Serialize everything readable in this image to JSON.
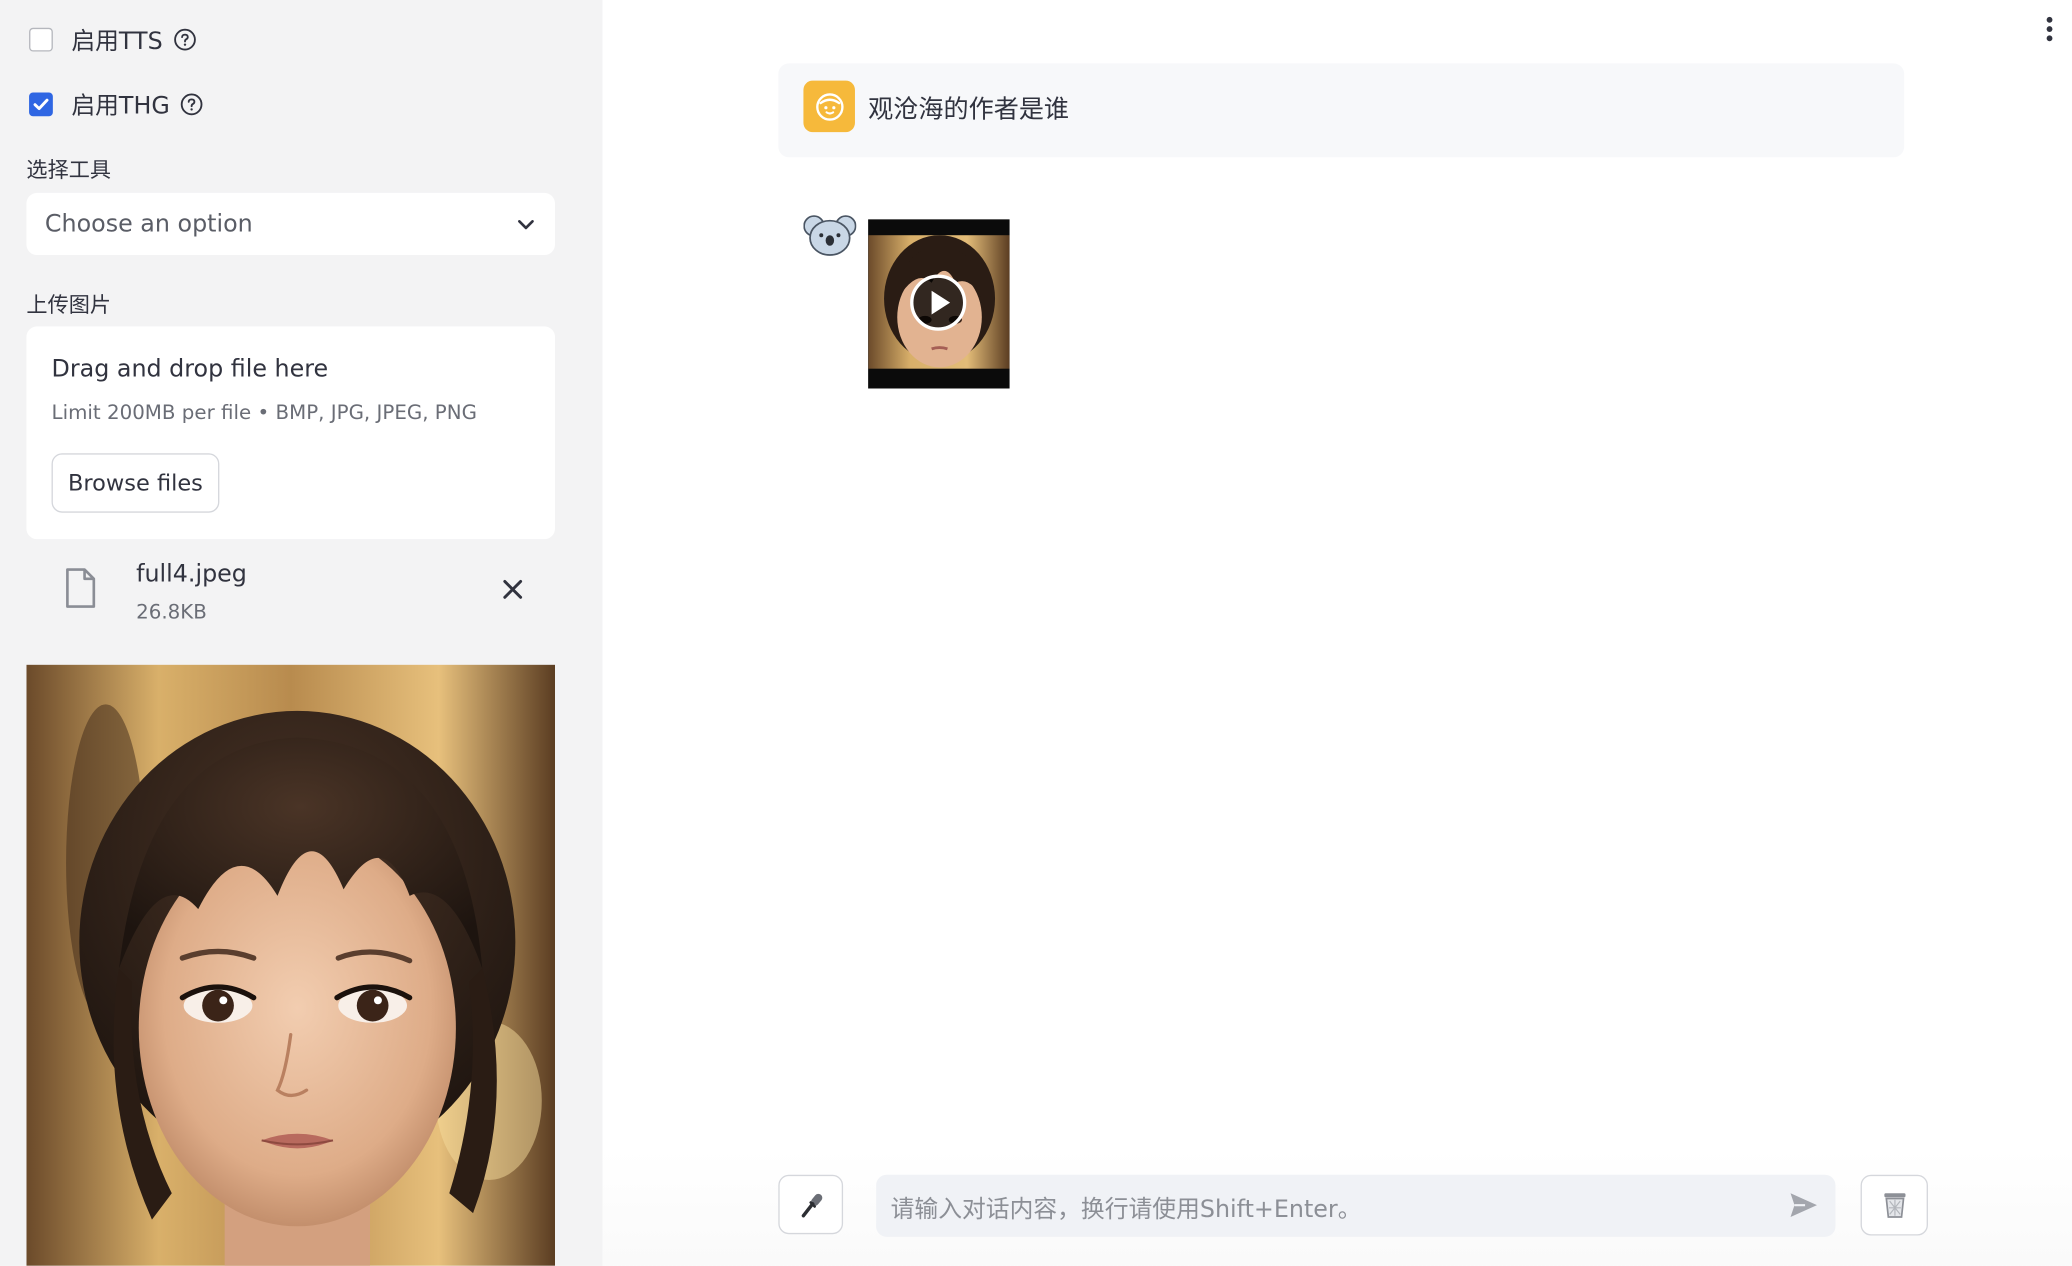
{
  "sidebar": {
    "tts": {
      "label": "启用TTS",
      "checked": false
    },
    "thg": {
      "label": "启用THG",
      "checked": true
    },
    "tool_select": {
      "label": "选择工具",
      "value": "Choose an option"
    },
    "upload": {
      "label": "上传图片",
      "drop_title": "Drag and drop file here",
      "limit": "Limit 200MB per file • BMP, JPG, JPEG, PNG",
      "browse_label": "Browse files"
    },
    "file": {
      "name": "full4.jpeg",
      "size": "26.8KB"
    }
  },
  "chat": {
    "messages": [
      {
        "role": "user",
        "text": "观沧海的作者是谁"
      },
      {
        "role": "assistant",
        "content": "video"
      }
    ],
    "input_placeholder": "请输入对话内容，换行请使用Shift+Enter。"
  },
  "icons": {
    "help": "help-circle-icon",
    "dropdown": "chevron-down-icon",
    "file": "file-icon",
    "remove": "close-icon",
    "menu": "kebab-menu-icon",
    "mic": "microphone-icon",
    "send": "send-icon",
    "clear": "trash-icon",
    "user_avatar": "baby-face-icon",
    "bot_avatar": "koala-icon"
  },
  "colors": {
    "sidebar_bg": "#f3f3f4",
    "checkbox_accent": "#2f66e3",
    "user_avatar_bg": "#f6b93b"
  }
}
